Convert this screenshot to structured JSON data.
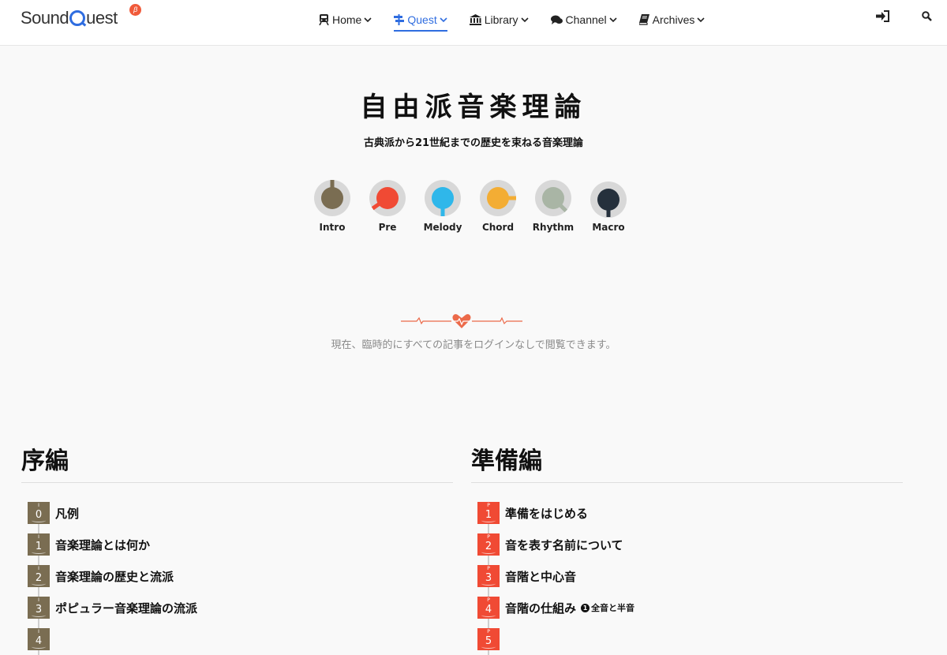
{
  "brand": {
    "name_pre": "Sound",
    "name_post": "uest",
    "beta": "β"
  },
  "nav": [
    {
      "label": "Home",
      "icon": "train-icon",
      "active": false
    },
    {
      "label": "Quest",
      "icon": "signpost-icon",
      "active": true
    },
    {
      "label": "Library",
      "icon": "institution-icon",
      "active": false
    },
    {
      "label": "Channel",
      "icon": "comments-icon",
      "active": false
    },
    {
      "label": "Archives",
      "icon": "book-icon",
      "active": false
    }
  ],
  "header_icons": [
    "sign-in-icon",
    "search-icon"
  ],
  "hero": {
    "title": "自由派音楽理論",
    "subtitle": "古典派から21世紀までの歴史を束ねる音楽理論"
  },
  "knobs": [
    {
      "label": "Intro",
      "color": "#7a6d52"
    },
    {
      "label": "Pre",
      "color": "#f04a34"
    },
    {
      "label": "Melody",
      "color": "#2fb7ea"
    },
    {
      "label": "Chord",
      "color": "#f3ad34"
    },
    {
      "label": "Rhythm",
      "color": "#a9b5a5"
    },
    {
      "label": "Macro",
      "color": "#25303c"
    }
  ],
  "notice": "現在、臨時的にすべての記事をログインなしで閲覧できます。",
  "sections": {
    "left": {
      "title": "序編",
      "color": "#7a6d52",
      "items": [
        {
          "prefix": "I",
          "num": "0",
          "label": "凡例"
        },
        {
          "prefix": "I",
          "num": "1",
          "label": "音楽理論とは何か"
        },
        {
          "prefix": "I",
          "num": "2",
          "label": "音楽理論の歴史と流派"
        },
        {
          "prefix": "I",
          "num": "3",
          "label": "ポピュラー音楽理論の流派"
        },
        {
          "prefix": "I",
          "num": "4",
          "label": ""
        }
      ]
    },
    "right": {
      "title": "準備編",
      "color": "#f04a34",
      "items": [
        {
          "prefix": "P",
          "num": "1",
          "label": "準備をはじめる"
        },
        {
          "prefix": "P",
          "num": "2",
          "label": "音を表す名前について"
        },
        {
          "prefix": "P",
          "num": "3",
          "label": "音階と中心音"
        },
        {
          "prefix": "P",
          "num": "4",
          "label": "音階の仕組み",
          "extra_num": "1",
          "extra": "全音と半音"
        },
        {
          "prefix": "P",
          "num": "5",
          "label": ""
        }
      ]
    }
  }
}
